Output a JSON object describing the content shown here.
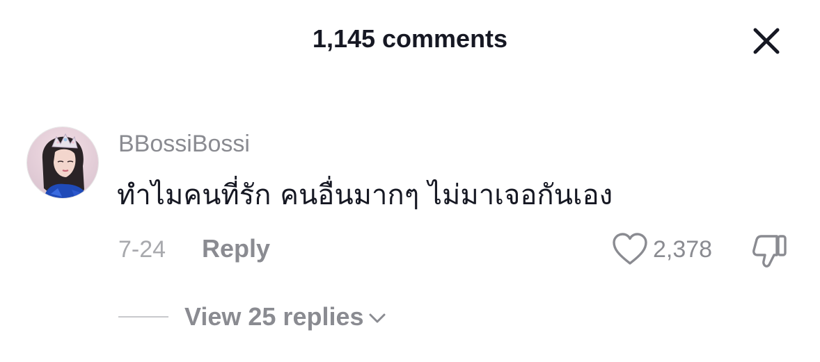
{
  "header": {
    "title": "1,145 comments",
    "close_icon": "close-icon"
  },
  "comment": {
    "username": "BBossiBossi",
    "text": "ทำไมคนที่รัก คนอื่นมากๆ ไม่มาเจอกันเอง",
    "date": "7-24",
    "reply_label": "Reply",
    "like_count": "2,378",
    "like_icon": "heart-outline-icon",
    "dislike_icon": "thumbs-down-icon",
    "view_replies_label": "View 25 replies",
    "view_replies_icon": "chevron-down-icon"
  },
  "colors": {
    "primary_text": "#161823",
    "secondary_text": "#8a8b91",
    "muted_text": "#a8a9ad",
    "background": "#ffffff"
  }
}
